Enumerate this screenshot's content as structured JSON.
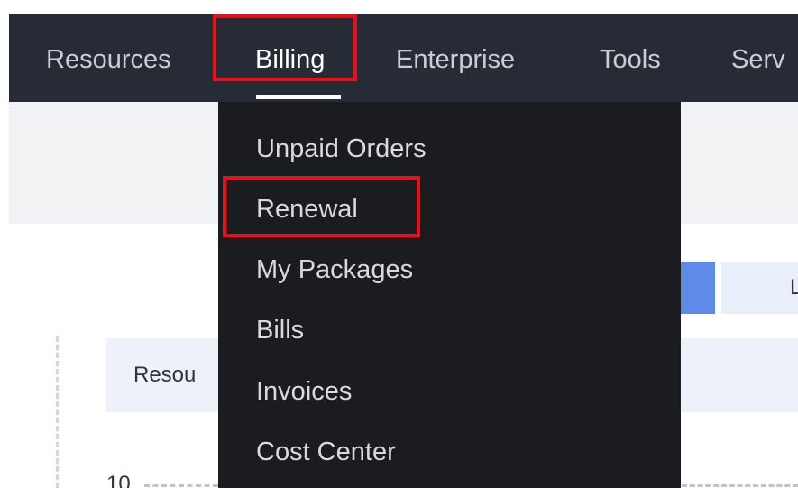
{
  "topnav": {
    "items": [
      {
        "label": "Resources"
      },
      {
        "label": "Billing"
      },
      {
        "label": "Enterprise"
      },
      {
        "label": "Tools"
      },
      {
        "label": "Serv"
      }
    ],
    "active": "Billing"
  },
  "billing_menu": {
    "items": [
      {
        "label": "Unpaid Orders"
      },
      {
        "label": "Renewal"
      },
      {
        "label": "My Packages"
      },
      {
        "label": "Bills"
      },
      {
        "label": "Invoices"
      },
      {
        "label": "Cost Center"
      }
    ]
  },
  "background": {
    "partial_button_label": "L",
    "resource_header_label": "Resou",
    "page_size_value": "10"
  },
  "colors": {
    "nav_bg": "#262b36",
    "dropdown_bg": "#1b1c1f",
    "highlight": "#e8111a",
    "primary_blue": "#5f8ae6"
  }
}
